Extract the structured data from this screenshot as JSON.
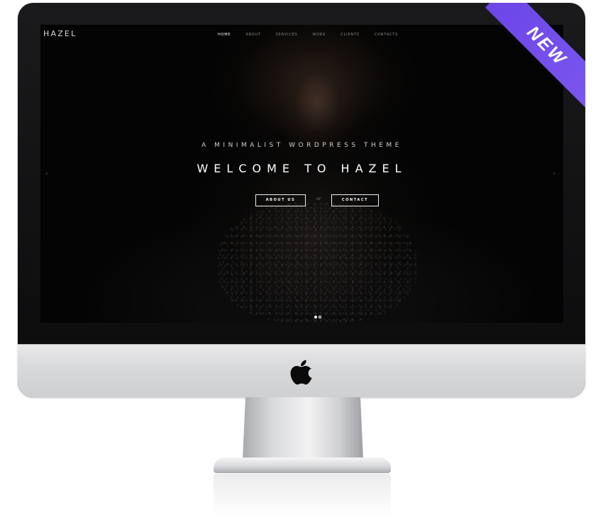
{
  "site": {
    "logo": "HAZEL",
    "nav": [
      "HOME",
      "ABOUT",
      "SERVICES",
      "WORK",
      "CLIENTS",
      "CONTACTS"
    ]
  },
  "hero": {
    "subtitle": "A MINIMALIST WORDPRESS THEME",
    "title": "WELCOME TO HAZEL",
    "primary_button": "ABOUT US",
    "separator": "or",
    "secondary_button": "CONTACT",
    "slide_count": 2,
    "active_slide": 1
  },
  "badge": {
    "text": "NEW",
    "color": "#6c46e8"
  },
  "icons": {
    "search": "search-icon",
    "prev": "chevron-left-icon",
    "next": "chevron-right-icon",
    "brand": "apple-logo-icon"
  }
}
